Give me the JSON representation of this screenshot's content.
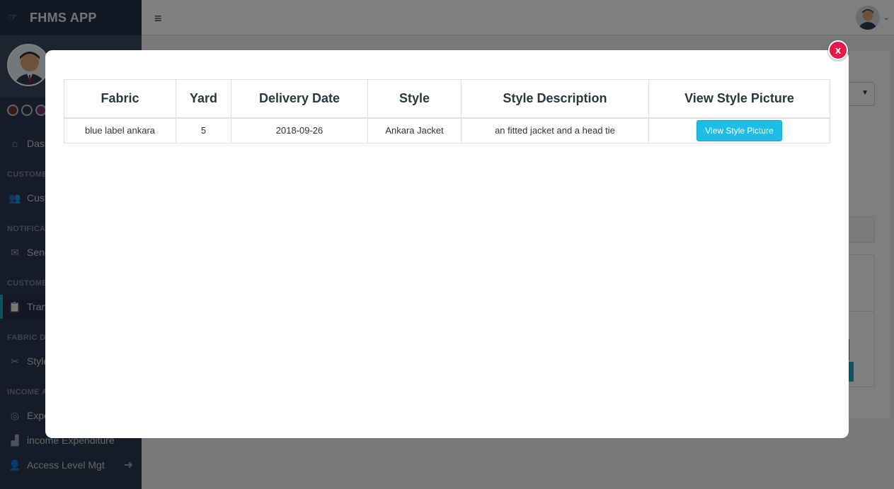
{
  "app": {
    "title": "FHMS APP"
  },
  "sidebar": {
    "sections": {
      "customers": "CUSTOME",
      "notifications": "NOTIFICAT",
      "customer2": "CUSTOME",
      "fabric": "FABRIC DI",
      "income": "INCOME A"
    },
    "items": [
      {
        "label": "Dash",
        "icon": "home-icon"
      },
      {
        "label": "Cust",
        "icon": "users-icon"
      },
      {
        "label": "Send",
        "icon": "envelope-icon"
      },
      {
        "label": "Tran",
        "icon": "clipboard-icon"
      },
      {
        "label": "Style",
        "icon": "scissors-icon"
      },
      {
        "label": "Expe",
        "icon": "coins-icon"
      },
      {
        "label": "income Expenditure",
        "icon": "bar-chart-icon"
      },
      {
        "label": "Access Level Mgt",
        "icon": "user-icon"
      }
    ],
    "swatch_colors": [
      "#6b3a2a",
      "#2c3750",
      "#7b2e7b"
    ]
  },
  "modal": {
    "close_label": "x",
    "table": {
      "headers": [
        "Fabric",
        "Yard",
        "Delivery Date",
        "Style",
        "Style Description",
        "View Style Picture"
      ],
      "rows": [
        {
          "fabric": "blue label ankara",
          "yard": "5",
          "delivery_date": "2018-09-26",
          "style": "Ankara Jacket",
          "style_description": "an fitted jacket and a head tie",
          "action_label": "View Style Picture"
        }
      ]
    }
  },
  "colors": {
    "sidebar_bg": "#2c3750",
    "accent": "#1ebde6",
    "close_button": "#e5194a"
  }
}
